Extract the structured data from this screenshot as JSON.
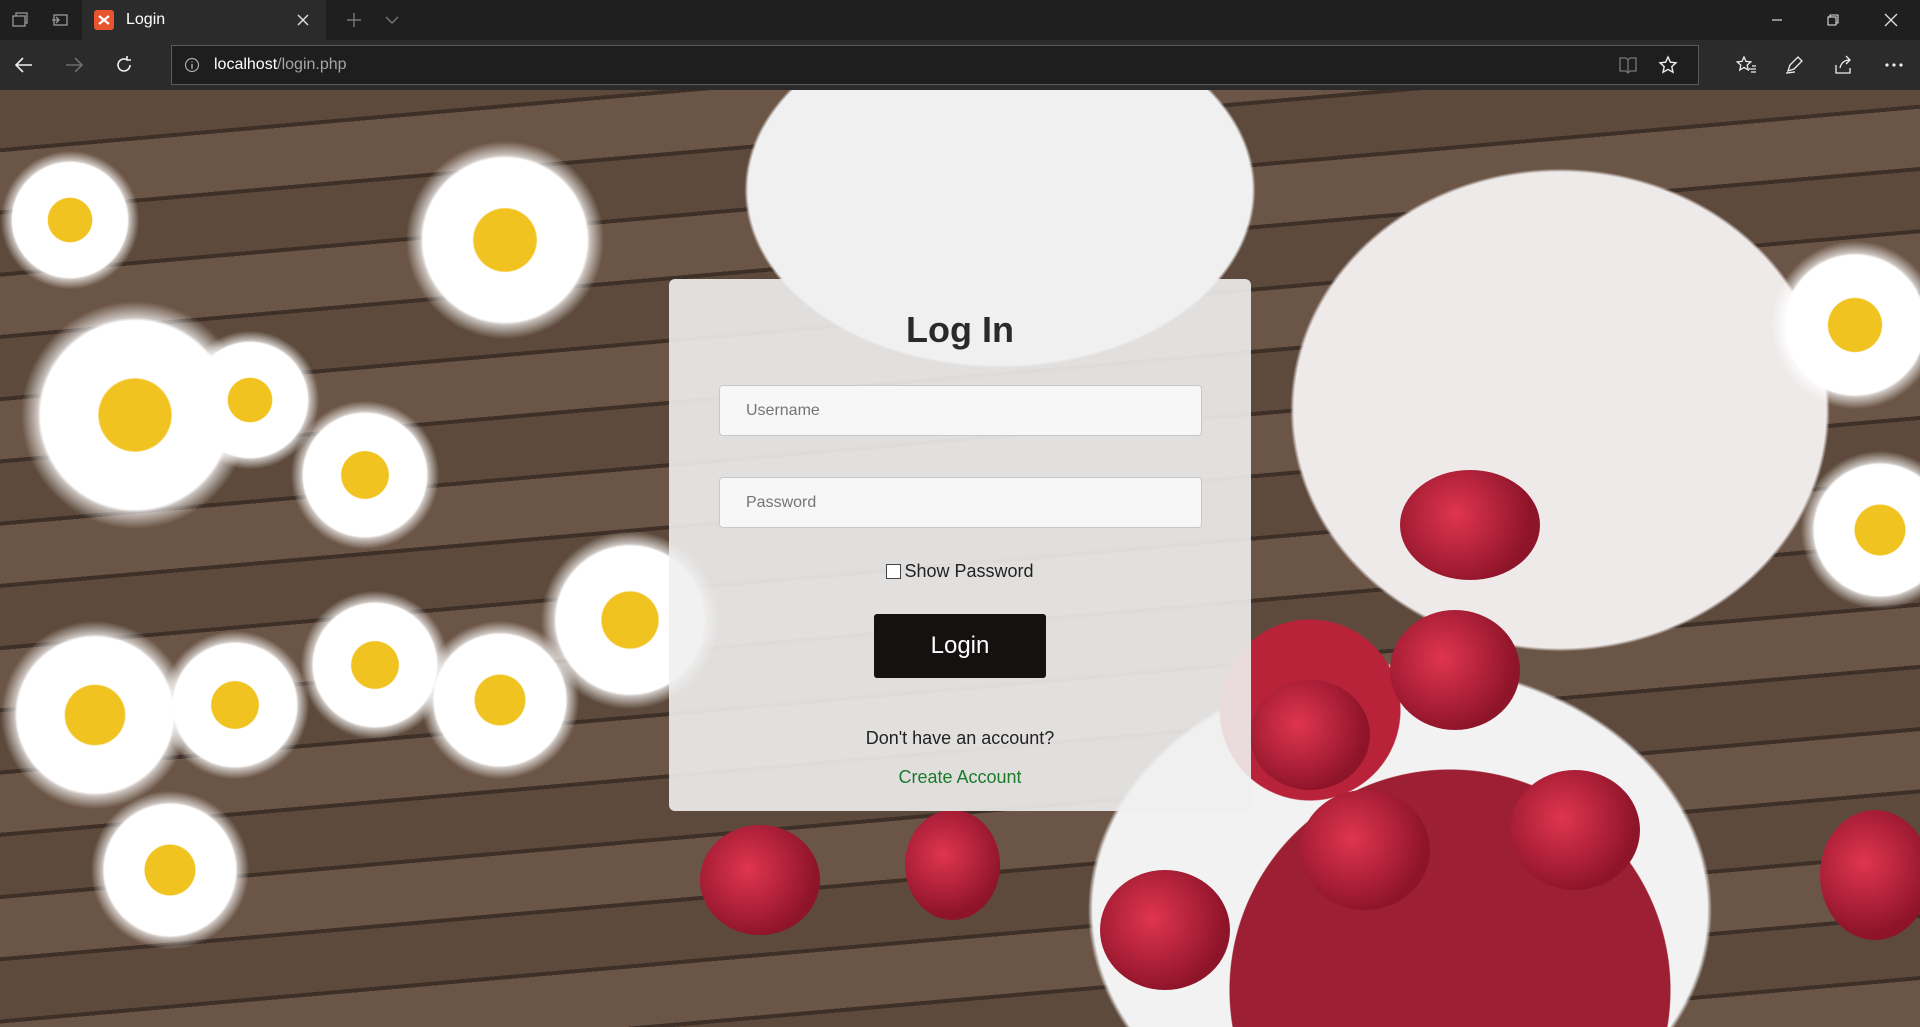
{
  "browser": {
    "tab": {
      "title": "Login",
      "favicon": "xampp-icon"
    },
    "address": {
      "host": "localhost",
      "path": "/login.php"
    }
  },
  "login": {
    "title": "Log In",
    "username_placeholder": "Username",
    "password_placeholder": "Password",
    "show_password_label": "Show Password",
    "login_button": "Login",
    "no_account_text": "Don't have an account?",
    "create_account_link": "Create Account"
  },
  "colors": {
    "card_bg": "#f0f0f0",
    "button_bg": "#141110",
    "link": "#1c7a2b",
    "chrome_dark": "#1f1f1f"
  }
}
